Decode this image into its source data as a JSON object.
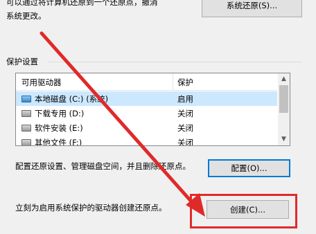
{
  "top": {
    "desc_line1": "可以通过将计算机还原到一个还原点，撤消",
    "desc_line2": "系统更改。",
    "restore_button": "系统还原(S)..."
  },
  "protection": {
    "group_label": "保护设置",
    "columns": [
      "可用驱动器",
      "保护"
    ],
    "drives": [
      {
        "name": "本地磁盘 (C:) (系统)",
        "status": "启用",
        "icon": "system-drive-icon"
      },
      {
        "name": "下载专用 (D:)",
        "status": "关闭",
        "icon": "drive-icon"
      },
      {
        "name": "软件安装 (E:)",
        "status": "关闭",
        "icon": "drive-icon"
      },
      {
        "name": "其他文件 (F:)",
        "status": "关闭",
        "icon": "drive-icon"
      }
    ]
  },
  "configure": {
    "text": "配置还原设置、管理磁盘空间，并且删除还原点。",
    "button": "配置(O)..."
  },
  "create": {
    "text": "立刻为启用系统保护的驱动器创建还原点。",
    "button": "创建(C)..."
  },
  "colors": {
    "annotation": "#e02a2a",
    "selection": "#cce8ff",
    "focus_border": "#0078d7"
  }
}
